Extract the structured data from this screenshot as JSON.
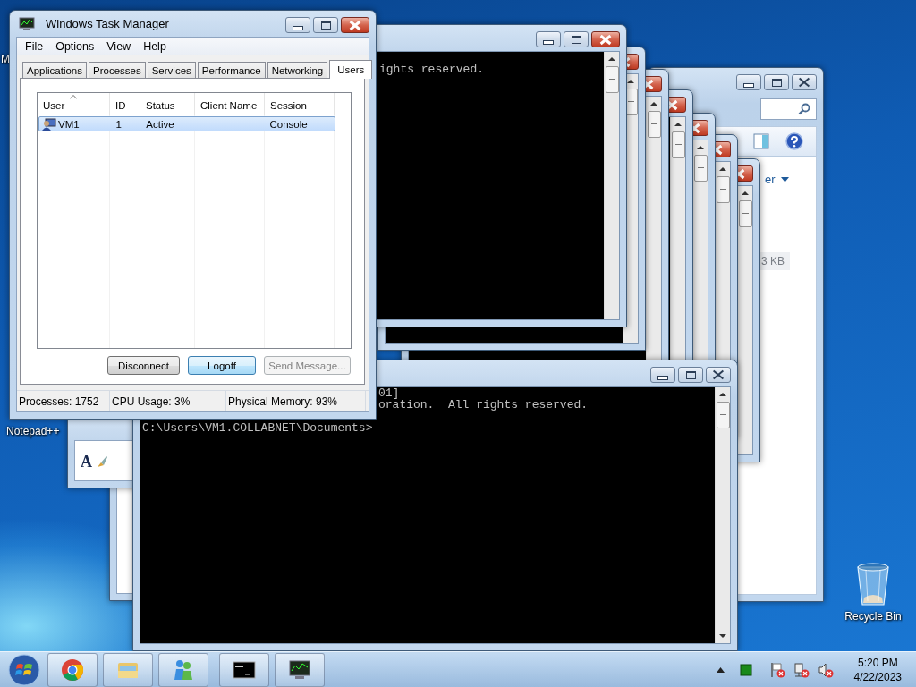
{
  "desktop_icons": [
    {
      "label": "M",
      "kind": "partial"
    },
    {
      "label": "Notepad++",
      "kind": "partial"
    },
    {
      "label": "Recycle Bin",
      "kind": "recycle-bin"
    }
  ],
  "task_manager": {
    "title": "Windows Task Manager",
    "menu": [
      "File",
      "Options",
      "View",
      "Help"
    ],
    "tabs": [
      {
        "label": "Applications",
        "selected": false
      },
      {
        "label": "Processes",
        "selected": false
      },
      {
        "label": "Services",
        "selected": false
      },
      {
        "label": "Performance",
        "selected": false
      },
      {
        "label": "Networking",
        "selected": false
      },
      {
        "label": "Users",
        "selected": true
      }
    ],
    "table": {
      "columns": [
        {
          "label": "User",
          "sorted": true
        },
        {
          "label": "ID",
          "sorted": false
        },
        {
          "label": "Status",
          "sorted": false
        },
        {
          "label": "Client Name",
          "sorted": false
        },
        {
          "label": "Session",
          "sorted": false
        }
      ],
      "rows": [
        {
          "selected": true,
          "user": "VM1",
          "id": "1",
          "status": "Active",
          "session": "Console"
        }
      ]
    },
    "buttons": [
      {
        "label": "Disconnect",
        "disabled": false,
        "hovered": false
      },
      {
        "label": "Logoff",
        "disabled": false,
        "hovered": true
      },
      {
        "label": "Send Message...",
        "disabled": true,
        "hovered": false
      }
    ],
    "status_bar": [
      "Processes: 1752",
      "CPU Usage: 3%",
      "Physical Memory: 93%"
    ]
  },
  "consoles": [
    {
      "lines": [
        {
          "text": "ights reserved.",
          "kind": "output"
        }
      ]
    },
    {
      "lines": [
        {
          "text": "01]",
          "kind": "output",
          "covered": true
        },
        {
          "text": "oration.  All rights reserved.",
          "kind": "output",
          "covered": true
        },
        {
          "text": "C:\\Users\\VM1.COLLABNET\\Documents>",
          "kind": "prompt"
        }
      ]
    }
  ],
  "explorer": {
    "command_label": "er",
    "size_label": "3 KB"
  },
  "wordpad": {
    "font_glyph": "A"
  },
  "taskbar": {
    "time": "5:20 PM",
    "date": "4/22/2023"
  }
}
